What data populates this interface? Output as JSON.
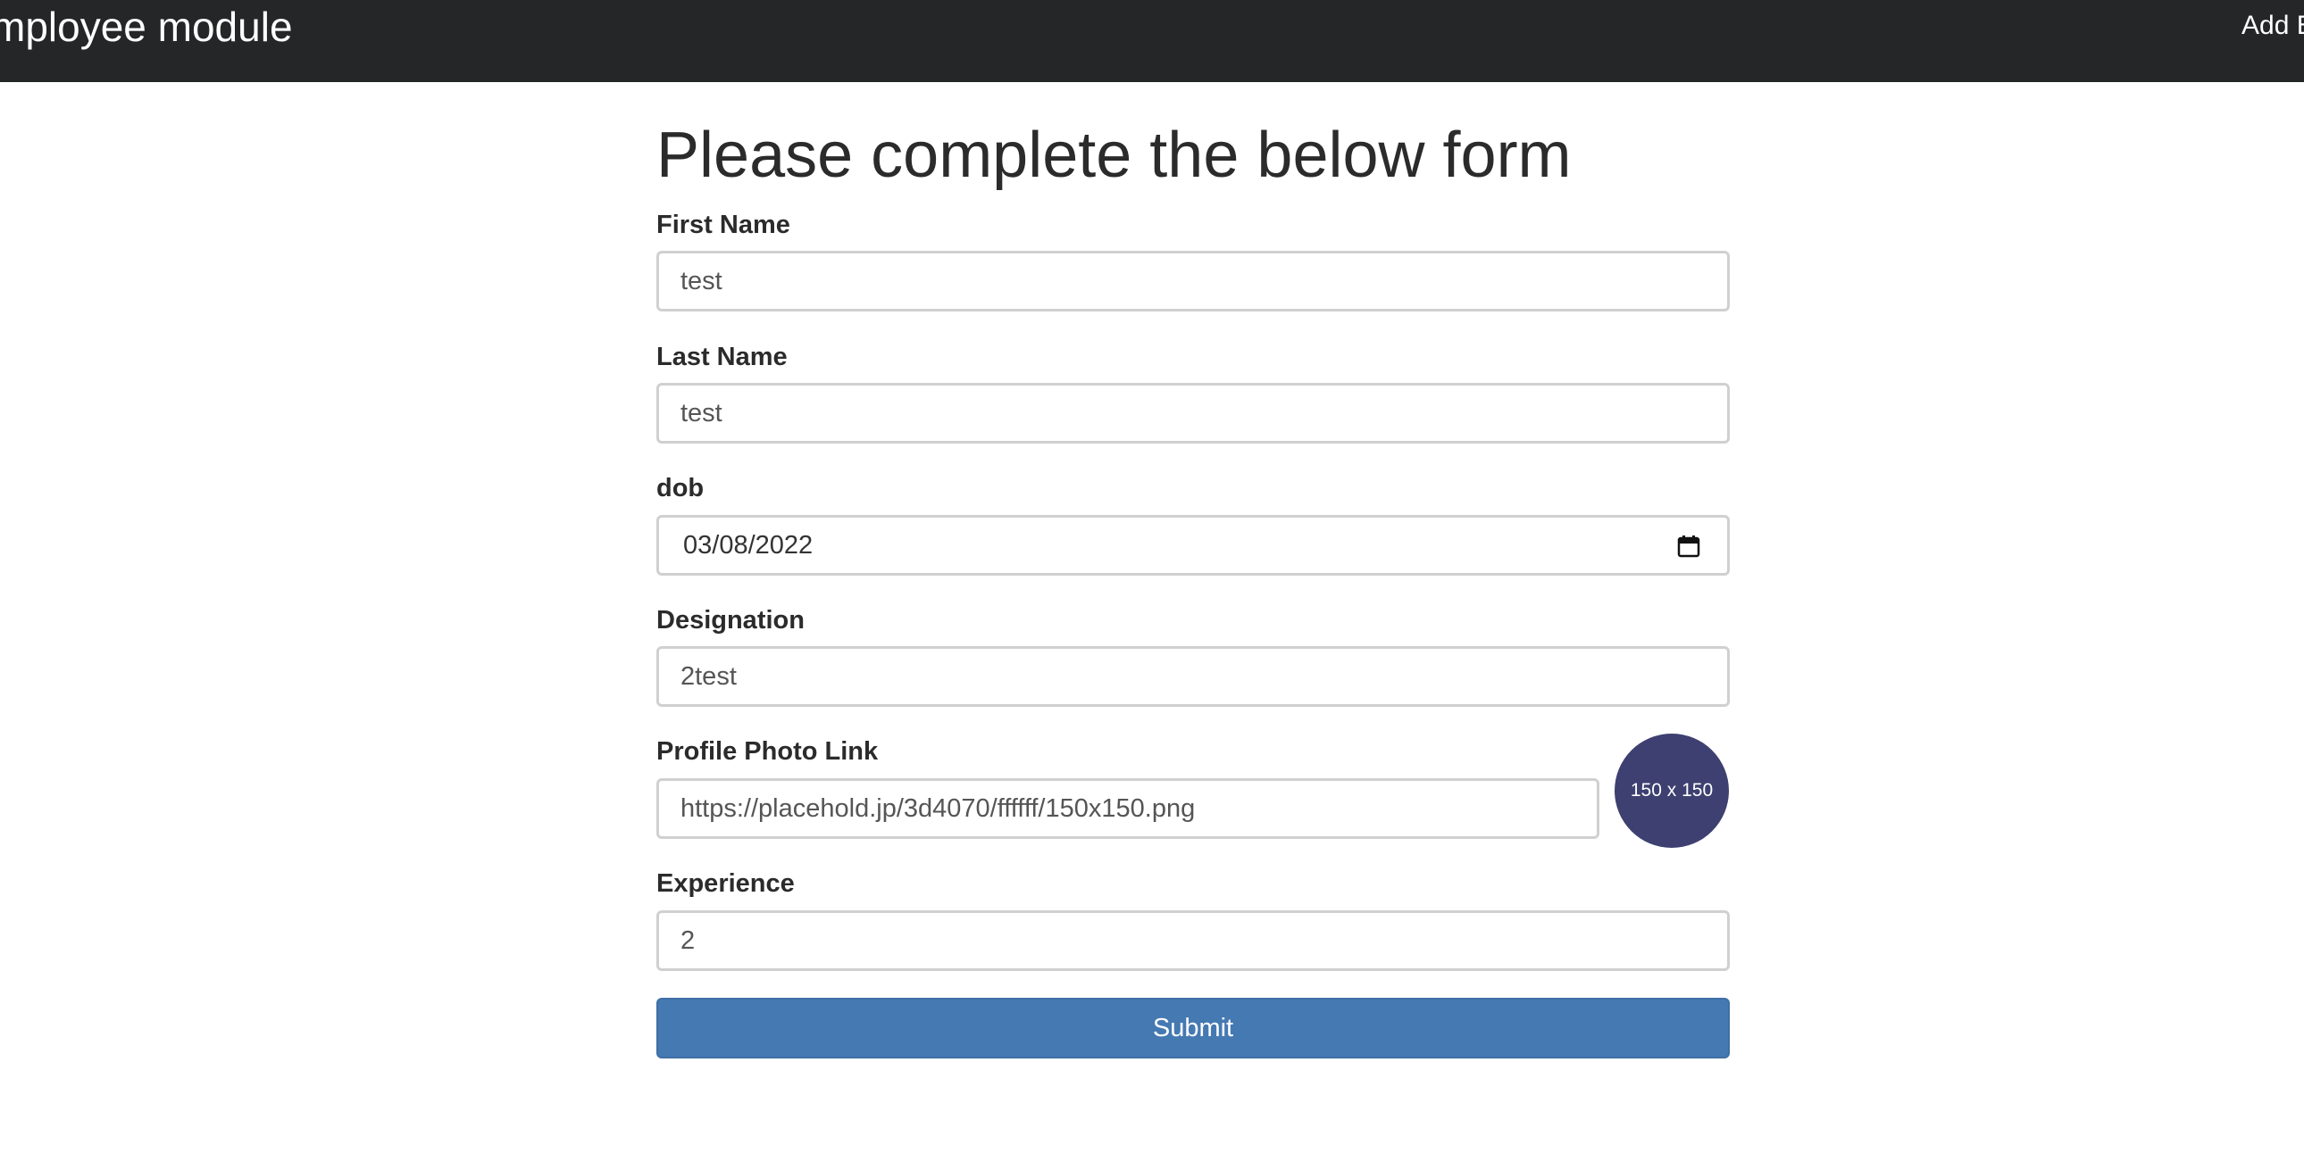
{
  "navbar": {
    "brand": "mployee module",
    "link": "Add E"
  },
  "form": {
    "title": "Please complete the below form",
    "first_name": {
      "label": "First Name",
      "value": "test"
    },
    "last_name": {
      "label": "Last Name",
      "value": "test"
    },
    "dob": {
      "label": "dob",
      "value": "03/08/2022",
      "icon": "calendar-icon"
    },
    "designation": {
      "label": "Designation",
      "value": "2test"
    },
    "photo": {
      "label": "Profile Photo Link",
      "value": "https://placehold.jp/3d4070/ffffff/150x150.png",
      "preview_text": "150 x 150",
      "preview_bg": "#3d4070"
    },
    "experience": {
      "label": "Experience",
      "value": "2"
    },
    "submit_label": "Submit"
  },
  "colors": {
    "navbar_bg": "#252628",
    "submit_bg": "#4579b2"
  }
}
